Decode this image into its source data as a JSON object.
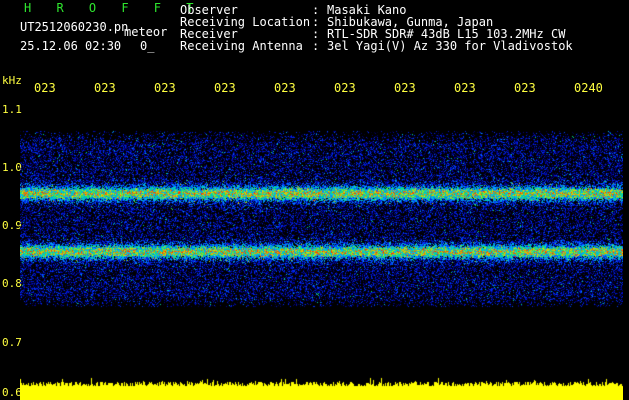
{
  "header": {
    "brand": "H R O F F T",
    "filename": "UT2512060230.pn",
    "mode": "meteor",
    "datetime": "25.12.06 02:30",
    "value": "0_",
    "meta": [
      {
        "label": "Observer",
        "value": "Masaki Kano"
      },
      {
        "label": "Receiving Location",
        "value": "Shibukawa, Gunma, Japan"
      },
      {
        "label": "Receiver",
        "value": "RTL-SDR SDR# 43dB L15 103.2MHz CW"
      },
      {
        "label": "Receiving Antenna",
        "value": "3el Yagi(V) Az 330 for Vladivostok"
      }
    ],
    "separator": ":"
  },
  "chart_data": {
    "type": "heatmap",
    "ylabel": "kHz",
    "y_ticks": [
      "1.1",
      "1.0",
      "0.9",
      "0.8",
      "0.7",
      "0.6"
    ],
    "y_tick_values": [
      1.1,
      1.0,
      0.9,
      0.8,
      0.7,
      0.6
    ],
    "x_ticks": [
      "023",
      "023",
      "023",
      "023",
      "023",
      "023",
      "023",
      "023",
      "023",
      "0240"
    ],
    "ylim": [
      0.6,
      1.12
    ],
    "noise_band_khz": [
      0.76,
      1.06
    ],
    "strong_bands_khz": [
      0.955,
      0.855
    ],
    "colors": {
      "tick_text": "#ffff40",
      "brand": "#2ee62e",
      "bottom_trace": "#ffff00",
      "grid_line": "#9a9a9a"
    }
  }
}
